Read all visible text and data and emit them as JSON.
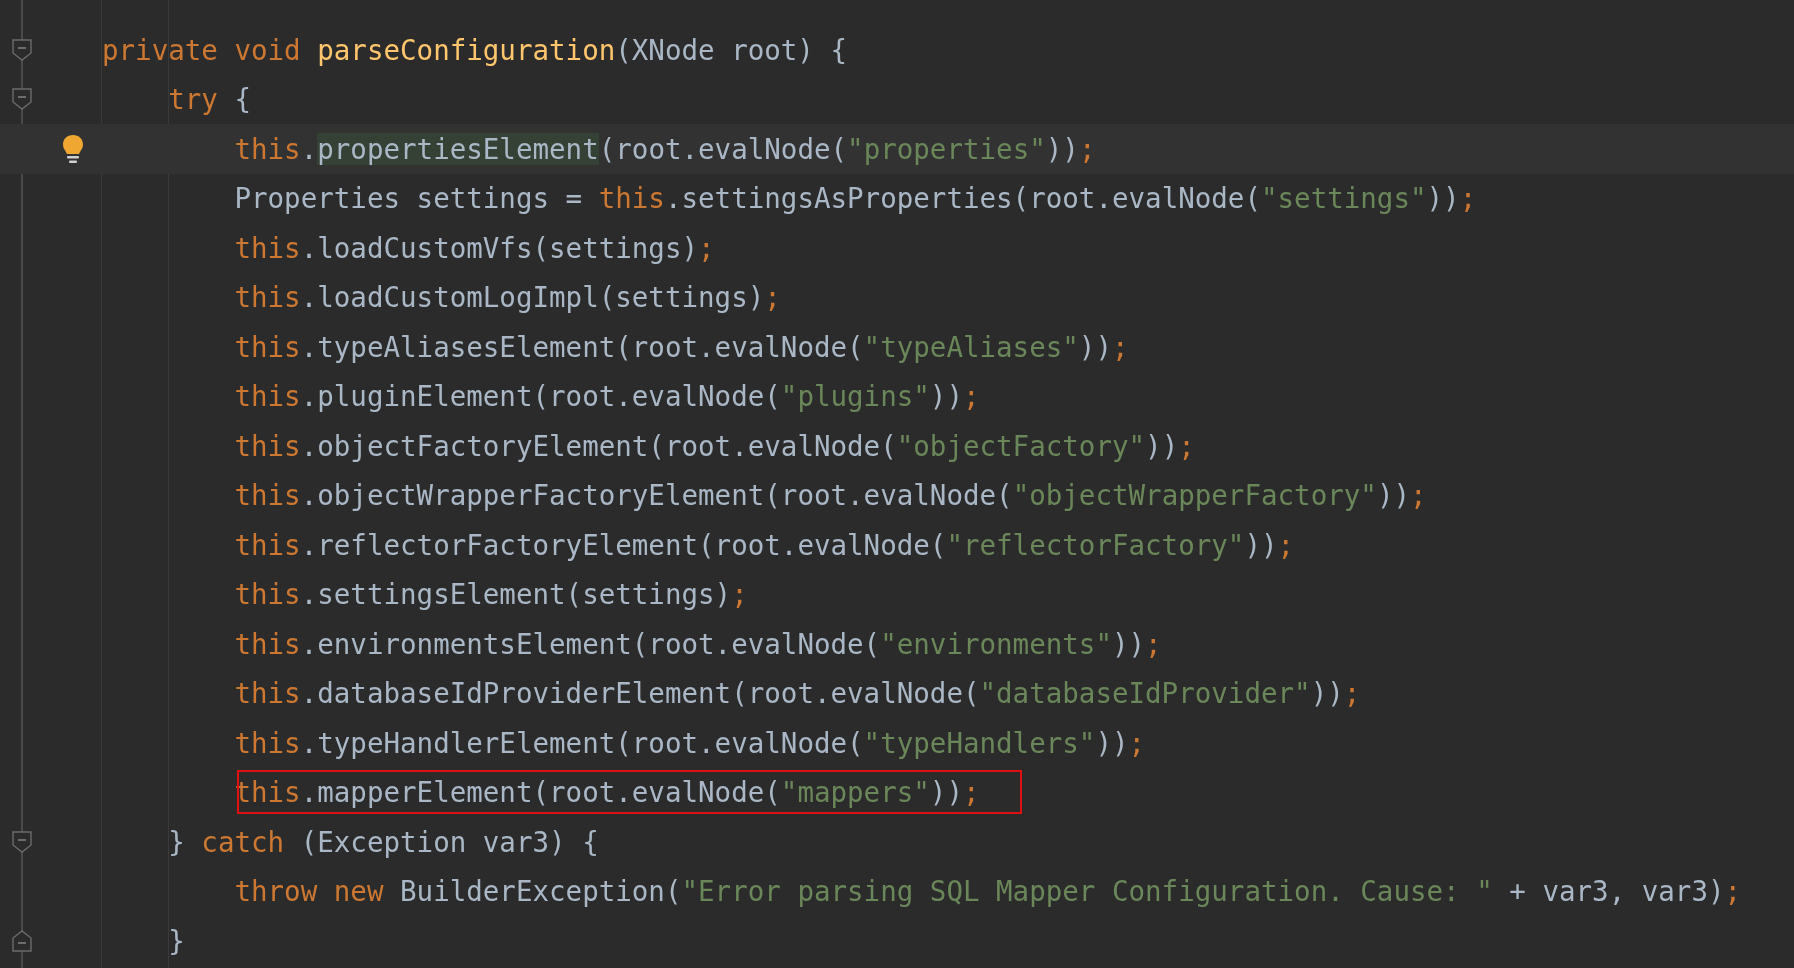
{
  "editor": {
    "lines": [
      {
        "fold_open": true,
        "tokens": [
          {
            "kind": "keyword",
            "text": "private void "
          },
          {
            "kind": "declaration",
            "text": "parseConfiguration"
          },
          {
            "kind": "plain",
            "text": "(XNode root) {"
          }
        ]
      },
      {
        "fold_open": true,
        "tokens": [
          {
            "kind": "keyword",
            "text": "    try"
          },
          {
            "kind": "plain",
            "text": " {"
          }
        ]
      },
      {
        "current": true,
        "bulb": true,
        "tokens": [
          {
            "kind": "keyword",
            "text": "        this"
          },
          {
            "kind": "plain",
            "text": "."
          },
          {
            "kind": "match",
            "text": "propertiesElement"
          },
          {
            "kind": "plain",
            "text": "(root.evalNode("
          },
          {
            "kind": "string",
            "text": "\"properties\""
          },
          {
            "kind": "plain",
            "text": "))"
          },
          {
            "kind": "keyword",
            "text": ";"
          }
        ]
      },
      {
        "tokens": [
          {
            "kind": "plain",
            "text": "        Properties settings = "
          },
          {
            "kind": "keyword",
            "text": "this"
          },
          {
            "kind": "plain",
            "text": ".settingsAsProperties(root.evalNode("
          },
          {
            "kind": "string",
            "text": "\"settings\""
          },
          {
            "kind": "plain",
            "text": "))"
          },
          {
            "kind": "keyword",
            "text": ";"
          }
        ]
      },
      {
        "tokens": [
          {
            "kind": "keyword",
            "text": "        this"
          },
          {
            "kind": "plain",
            "text": ".loadCustomVfs(settings)"
          },
          {
            "kind": "keyword",
            "text": ";"
          }
        ]
      },
      {
        "tokens": [
          {
            "kind": "keyword",
            "text": "        this"
          },
          {
            "kind": "plain",
            "text": ".loadCustomLogImpl(settings)"
          },
          {
            "kind": "keyword",
            "text": ";"
          }
        ]
      },
      {
        "tokens": [
          {
            "kind": "keyword",
            "text": "        this"
          },
          {
            "kind": "plain",
            "text": ".typeAliasesElement(root.evalNode("
          },
          {
            "kind": "string",
            "text": "\"typeAliases\""
          },
          {
            "kind": "plain",
            "text": "))"
          },
          {
            "kind": "keyword",
            "text": ";"
          }
        ]
      },
      {
        "tokens": [
          {
            "kind": "keyword",
            "text": "        this"
          },
          {
            "kind": "plain",
            "text": ".pluginElement(root.evalNode("
          },
          {
            "kind": "string",
            "text": "\"plugins\""
          },
          {
            "kind": "plain",
            "text": "))"
          },
          {
            "kind": "keyword",
            "text": ";"
          }
        ]
      },
      {
        "tokens": [
          {
            "kind": "keyword",
            "text": "        this"
          },
          {
            "kind": "plain",
            "text": ".objectFactoryElement(root.evalNode("
          },
          {
            "kind": "string",
            "text": "\"objectFactory\""
          },
          {
            "kind": "plain",
            "text": "))"
          },
          {
            "kind": "keyword",
            "text": ";"
          }
        ]
      },
      {
        "tokens": [
          {
            "kind": "keyword",
            "text": "        this"
          },
          {
            "kind": "plain",
            "text": ".objectWrapperFactoryElement(root.evalNode("
          },
          {
            "kind": "string",
            "text": "\"objectWrapperFactory\""
          },
          {
            "kind": "plain",
            "text": "))"
          },
          {
            "kind": "keyword",
            "text": ";"
          }
        ]
      },
      {
        "tokens": [
          {
            "kind": "keyword",
            "text": "        this"
          },
          {
            "kind": "plain",
            "text": ".reflectorFactoryElement(root.evalNode("
          },
          {
            "kind": "string",
            "text": "\"reflectorFactory\""
          },
          {
            "kind": "plain",
            "text": "))"
          },
          {
            "kind": "keyword",
            "text": ";"
          }
        ]
      },
      {
        "tokens": [
          {
            "kind": "keyword",
            "text": "        this"
          },
          {
            "kind": "plain",
            "text": ".settingsElement(settings)"
          },
          {
            "kind": "keyword",
            "text": ";"
          }
        ]
      },
      {
        "tokens": [
          {
            "kind": "keyword",
            "text": "        this"
          },
          {
            "kind": "plain",
            "text": ".environmentsElement(root.evalNode("
          },
          {
            "kind": "string",
            "text": "\"environments\""
          },
          {
            "kind": "plain",
            "text": "))"
          },
          {
            "kind": "keyword",
            "text": ";"
          }
        ]
      },
      {
        "tokens": [
          {
            "kind": "keyword",
            "text": "        this"
          },
          {
            "kind": "plain",
            "text": ".databaseIdProviderElement(root.evalNode("
          },
          {
            "kind": "string",
            "text": "\"databaseIdProvider\""
          },
          {
            "kind": "plain",
            "text": "))"
          },
          {
            "kind": "keyword",
            "text": ";"
          }
        ]
      },
      {
        "tokens": [
          {
            "kind": "keyword",
            "text": "        this"
          },
          {
            "kind": "plain",
            "text": ".typeHandlerElement(root.evalNode("
          },
          {
            "kind": "string",
            "text": "\"typeHandlers\""
          },
          {
            "kind": "plain",
            "text": "))"
          },
          {
            "kind": "keyword",
            "text": ";"
          }
        ]
      },
      {
        "boxed": true,
        "tokens": [
          {
            "kind": "keyword",
            "text": "        this"
          },
          {
            "kind": "plain",
            "text": ".mapperElement(root.evalNode("
          },
          {
            "kind": "string",
            "text": "\"mappers\""
          },
          {
            "kind": "plain",
            "text": "))"
          },
          {
            "kind": "keyword",
            "text": ";"
          }
        ]
      },
      {
        "fold_open": true,
        "tokens": [
          {
            "kind": "plain",
            "text": "    } "
          },
          {
            "kind": "keyword",
            "text": "catch"
          },
          {
            "kind": "plain",
            "text": " (Exception var3) {"
          }
        ]
      },
      {
        "tokens": [
          {
            "kind": "keyword",
            "text": "        throw new"
          },
          {
            "kind": "plain",
            "text": " BuilderException("
          },
          {
            "kind": "string",
            "text": "\"Error parsing SQL Mapper Configuration. Cause: \""
          },
          {
            "kind": "plain",
            "text": " + var3, var3)"
          },
          {
            "kind": "keyword",
            "text": ";"
          }
        ]
      },
      {
        "fold_close": true,
        "tokens": [
          {
            "kind": "plain",
            "text": "    }"
          }
        ]
      }
    ]
  }
}
